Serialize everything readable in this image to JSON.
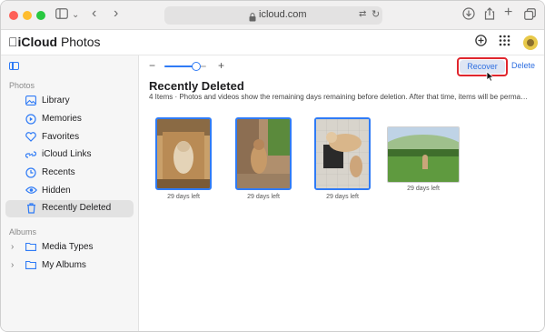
{
  "browser": {
    "address": "icloud.com",
    "lock_icon": "lock-icon",
    "translate_icon": "translate-icon",
    "reload_icon": "reload-icon"
  },
  "app": {
    "brand": "iCloud",
    "title": "Photos"
  },
  "sidebar": {
    "photos_section": "Photos",
    "albums_section": "Albums",
    "items": [
      {
        "label": "Library",
        "icon": "library-icon"
      },
      {
        "label": "Memories",
        "icon": "memories-icon"
      },
      {
        "label": "Favorites",
        "icon": "heart-icon"
      },
      {
        "label": "iCloud Links",
        "icon": "link-icon"
      },
      {
        "label": "Recents",
        "icon": "clock-icon"
      },
      {
        "label": "Hidden",
        "icon": "eye-icon"
      },
      {
        "label": "Recently Deleted",
        "icon": "trash-icon"
      }
    ],
    "albums": [
      {
        "label": "Media Types",
        "icon": "folder-icon"
      },
      {
        "label": "My Albums",
        "icon": "folder-icon"
      }
    ]
  },
  "toolbar": {
    "zoom_level": 0.75,
    "recover_label": "Recover",
    "delete_label": "Delete"
  },
  "main": {
    "heading": "Recently Deleted",
    "subtitle": "4 Items · Photos and videos show the remaining days remaining before deletion. After that time, items will be perma…",
    "photos": [
      {
        "caption": "29 days left"
      },
      {
        "caption": "29 days left"
      },
      {
        "caption": "29 days left"
      },
      {
        "caption": "29 days left"
      }
    ]
  },
  "colors": {
    "accent": "#2f7bf6",
    "highlight": "#e0262e"
  }
}
